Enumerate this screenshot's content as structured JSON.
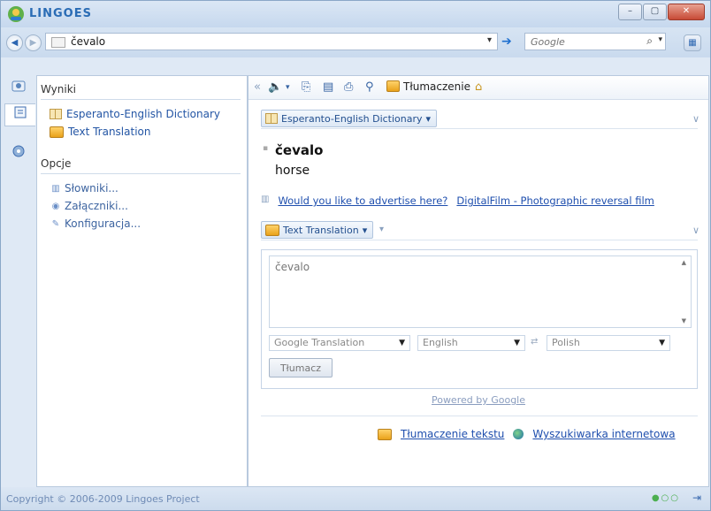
{
  "window": {
    "title": "LINGOES",
    "controls": {
      "minimize": "–",
      "maximize": "▢",
      "close": "✕"
    }
  },
  "address_bar": {
    "back": "◀",
    "forward": "▶",
    "query": "čevalo",
    "dropdown": "▾",
    "go": "➔",
    "search_placeholder": "Google",
    "search_icon": "⌕",
    "search_dropdown": "▾",
    "menu": "▦"
  },
  "rail": {
    "icons": [
      "results-icon",
      "dictionary-icon",
      "options-icon"
    ]
  },
  "sidebar": {
    "results_heading": "Wyniki",
    "results": [
      {
        "label": "Esperanto-English Dictionary",
        "icon": "book-icon"
      },
      {
        "label": "Text Translation",
        "icon": "text-translation-icon"
      }
    ],
    "options_heading": "Opcje",
    "options": [
      {
        "label": "Słowniki...",
        "icon": "dictionaries-icon"
      },
      {
        "label": "Załączniki...",
        "icon": "attachments-icon"
      },
      {
        "label": "Konfiguracja...",
        "icon": "config-icon"
      }
    ]
  },
  "toolbar": {
    "back": "«",
    "speak": "🔈",
    "speak_dd": "▾",
    "copy": "⎘",
    "save": "▤",
    "print": "⎙",
    "find": "⚲",
    "translate_label": "Tłumaczenie",
    "home": "⌂"
  },
  "dictionary_panel": {
    "title": "Esperanto-English Dictionary",
    "dropdown": "▾",
    "collapse": "∨",
    "headword": "čevalo",
    "definition": "horse",
    "ad_question": "Would you like to advertise here?",
    "ad_link": "DigitalFilm - Photographic reversal film"
  },
  "translation_panel": {
    "title": "Text Translation",
    "dropdown": "▾",
    "extra": "▾",
    "collapse": "∨",
    "input_text": "čevalo",
    "engine": "Google Translation",
    "from_language": "English",
    "to_language": "Polish",
    "translate_button": "Tłumacz",
    "powered_by": "Powered by Google"
  },
  "bottom_links": {
    "text_translation": "Tłumaczenie tekstu",
    "web_search": "Wyszukiwarka internetowa"
  },
  "status": {
    "copyright": "Copyright © 2006-2009 Lingoes Project",
    "dots": "●○○",
    "pin": "⇥"
  }
}
